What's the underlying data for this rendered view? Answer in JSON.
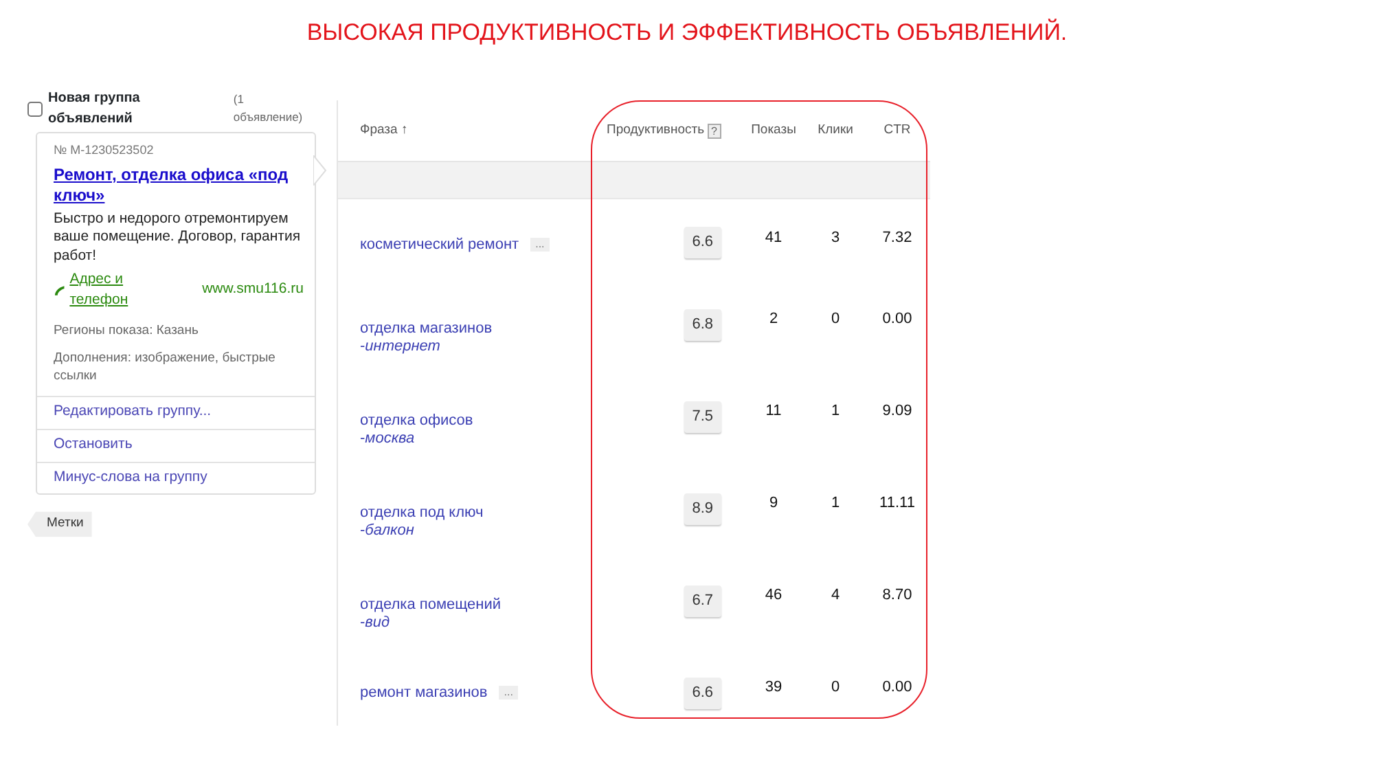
{
  "slide_title": "ВЫСОКАЯ ПРОДУКТИВНОСТЬ И ЭФФЕКТИВНОСТЬ ОБЪЯВЛЕНИЙ.",
  "ad_group": {
    "checked": false,
    "name": "Новая группа объявлений",
    "count": "(1 объявление)",
    "number": "№ M-1230523502",
    "ad_title": "Ремонт, отделка офиса «под ключ»",
    "ad_text": "Быстро и недорого отремонтируем ваше помещение. Договор, гарантия работ!",
    "contact_link": "Адрес и телефон",
    "site": "www.smu116.ru",
    "regions": "Регионы показа: Казань",
    "extras": "Дополнения: изображение, быстрые ссылки",
    "actions": [
      "Редактировать группу...",
      "Остановить",
      "Минус-слова на группу"
    ]
  },
  "tags_button": "Метки",
  "table": {
    "columns": [
      {
        "label": "Фраза ↑"
      },
      {
        "label": "Продуктивность",
        "help": "?"
      },
      {
        "label": "Показы"
      },
      {
        "label": "Клики"
      },
      {
        "label": "CTR"
      }
    ],
    "rows": [
      {
        "phrase": "косметический ремонт",
        "more": "...",
        "productivity": "6.6",
        "shows": "41",
        "clicks": "3",
        "ctr": "7.32"
      },
      {
        "phrase": "отделка магазинов  -*интернет*",
        "productivity": "6.8",
        "shows": "2",
        "clicks": "0",
        "ctr": "0.00"
      },
      {
        "phrase": "отделка офисов  -*москва*",
        "productivity": "7.5",
        "shows": "11",
        "clicks": "1",
        "ctr": "9.09"
      },
      {
        "phrase": "отделка под ключ  -*балкон*",
        "productivity": "8.9",
        "shows": "9",
        "clicks": "1",
        "ctr": "11.11"
      },
      {
        "phrase": "отделка помещений  -*вид*",
        "productivity": "6.7",
        "shows": "46",
        "clicks": "4",
        "ctr": "8.70"
      },
      {
        "phrase": "ремонт магазинов",
        "more": "...",
        "productivity": "6.6",
        "shows": "39",
        "clicks": "0",
        "ctr": "0.00"
      }
    ]
  }
}
